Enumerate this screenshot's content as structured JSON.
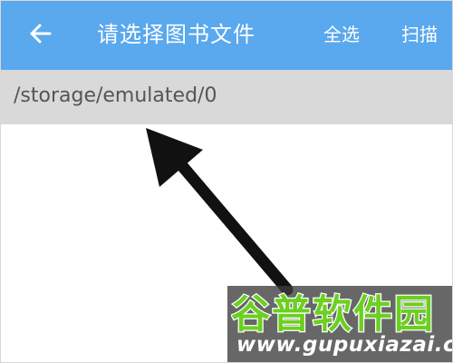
{
  "app_bar": {
    "title": "请选择图书文件",
    "select_all_label": "全选",
    "scan_label": "扫描",
    "back_icon": "arrow-left-icon"
  },
  "path_bar": {
    "path": "/storage/emulated/0"
  },
  "watermark": {
    "logo_text": "谷普软件园",
    "url": "www.gupuxiazai.com"
  },
  "colors": {
    "app_bar_bg": "#5aa8ee",
    "path_bar_bg": "#d9d9d9",
    "path_text": "#555555",
    "arrow": "#111111",
    "logo_green": "#6bd020"
  }
}
